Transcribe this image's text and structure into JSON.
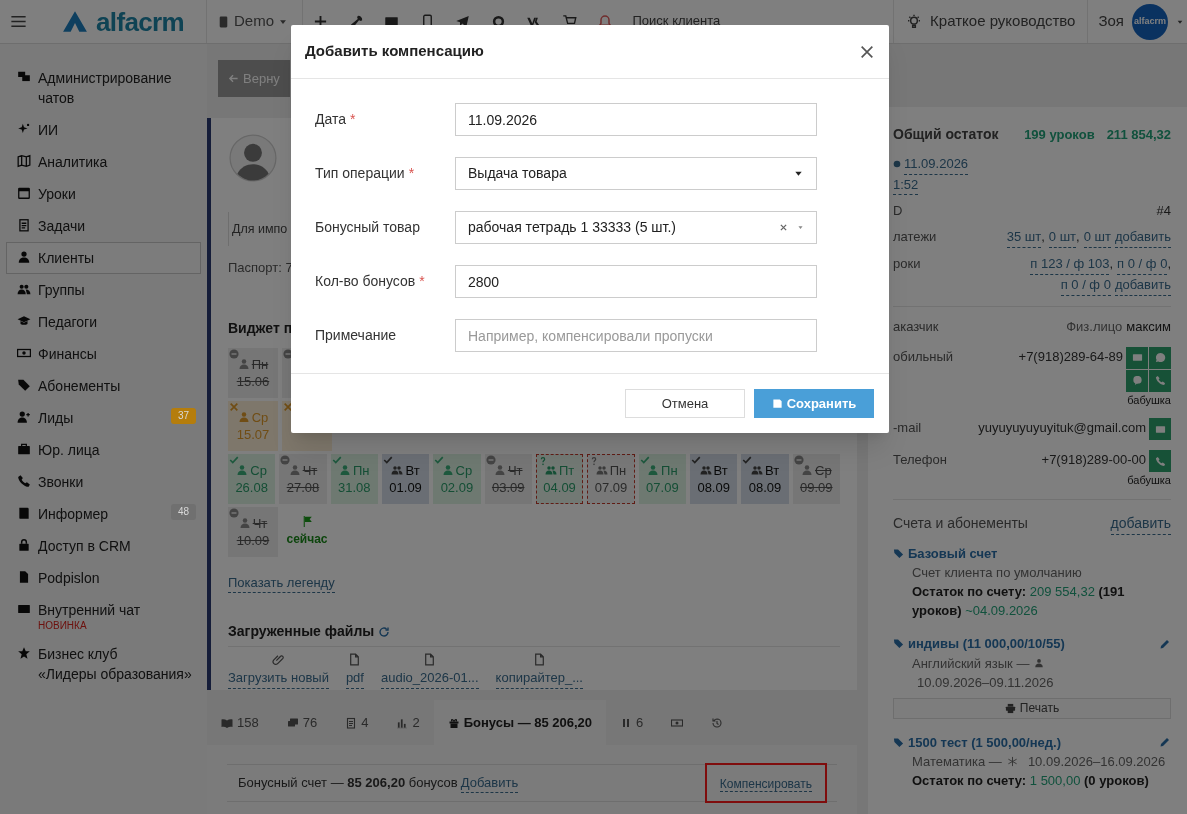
{
  "top_bar": {
    "logo": "alfacrm",
    "branch": "Demo",
    "search_placeholder": "Поиск клиента",
    "guide": "Краткое руководство",
    "user": "Зоя",
    "avatar_text": "alfacrm"
  },
  "sidebar": {
    "items": [
      {
        "label": "Администрирование чатов",
        "selected": false
      },
      {
        "label": "ИИ",
        "selected": false
      },
      {
        "label": "Аналитика",
        "selected": false
      },
      {
        "label": "Уроки",
        "selected": false
      },
      {
        "label": "Задачи",
        "selected": false
      },
      {
        "label": "Клиенты",
        "selected": true
      },
      {
        "label": "Группы",
        "selected": false
      },
      {
        "label": "Педагоги",
        "selected": false
      },
      {
        "label": "Финансы",
        "selected": false
      },
      {
        "label": "Абонементы",
        "selected": false
      },
      {
        "label": "Лиды",
        "selected": false,
        "badge": "37",
        "color": "#b57d0c"
      },
      {
        "label": "Юр. лица",
        "selected": false
      },
      {
        "label": "Звонки",
        "selected": false
      },
      {
        "label": "Информер",
        "selected": false,
        "badge": "48",
        "color": "#707070"
      },
      {
        "label": "Доступ в CRM",
        "selected": false
      },
      {
        "label": "Podpislon",
        "selected": false
      },
      {
        "label": "Внутренний чат",
        "selected": false,
        "note": "НОВИНКА"
      },
      {
        "label": "Бизнес клуб\n«Лидеры образования»",
        "selected": false
      }
    ]
  },
  "main": {
    "back_button": "Верну",
    "import_note": "Для импо",
    "passport": "Паспорт: 7",
    "widget_title": "Виджет п",
    "lesson_rows": [
      [
        {
          "kind": "cancelled",
          "weekday": "Пн",
          "date": "15.06",
          "group": false
        },
        {
          "kind": "cancelled"
        }
      ],
      [
        {
          "kind": "missed",
          "weekday": "Ср",
          "date": "15.07",
          "group": false
        },
        {
          "kind": "missed"
        }
      ],
      [
        {
          "kind": "attended",
          "weekday": "Ср",
          "date": "26.08",
          "group": false
        },
        {
          "kind": "cancelled",
          "weekday": "Чт",
          "date": "27.08",
          "group": false
        },
        {
          "kind": "attended",
          "weekday": "Пн",
          "date": "31.08",
          "group": false
        },
        {
          "kind": "visited",
          "weekday": "Вт",
          "date": "01.09",
          "group": true
        },
        {
          "kind": "attended",
          "weekday": "Ср",
          "date": "02.09",
          "group": false
        },
        {
          "kind": "cancelled",
          "weekday": "Чт",
          "date": "03.09",
          "group": false
        },
        {
          "kind": "pending_attended",
          "weekday": "Пт",
          "date": "04.09",
          "group": true
        },
        {
          "kind": "pending",
          "weekday": "Пн",
          "date": "07.09",
          "group": true
        },
        {
          "kind": "attended",
          "weekday": "Пн",
          "date": "07.09",
          "group": false
        },
        {
          "kind": "visited",
          "weekday": "Вт",
          "date": "08.09",
          "group": true
        },
        {
          "kind": "visited",
          "weekday": "Вт",
          "date": "08.09",
          "group": true
        },
        {
          "kind": "cancelled",
          "weekday": "Ср",
          "date": "09.09",
          "group": false
        }
      ],
      [
        {
          "kind": "cancelled",
          "weekday": "Чт",
          "date": "10.09",
          "group": false
        },
        {
          "kind": "now",
          "label": "сейчас"
        }
      ]
    ],
    "legend_link": "Показать легенду",
    "files_title": "Загруженные файлы",
    "files": [
      {
        "kind": "upload",
        "label": "Загрузить новый"
      },
      {
        "kind": "file",
        "label": "pdf"
      },
      {
        "kind": "file",
        "label": "audio_2026-01..."
      },
      {
        "kind": "file",
        "label": "копирайтер_..."
      }
    ]
  },
  "tabs": [
    {
      "label": "158",
      "selected": false
    },
    {
      "label": "76",
      "selected": false
    },
    {
      "label": "4",
      "selected": false
    },
    {
      "label": "2",
      "selected": false
    },
    {
      "label": "Бонусы — 85 206,20",
      "selected": true
    },
    {
      "label": "6",
      "selected": false
    },
    {
      "selected": false
    },
    {
      "selected": false
    }
  ],
  "bonus": {
    "text": "Бонусный счет — **85 206,20** бонусов",
    "add_link": "Добавить",
    "compensate_link": "Компенсировать",
    "highlighted": true
  },
  "client_panel": {
    "summary": {
      "label": "Общий остаток",
      "lessons": "199 уроков",
      "amount": "211 854,32",
      "date": "11.09.2026",
      "time": "1:52"
    },
    "info": [
      {
        "label": "D",
        "values": [
          {
            "kind": "plain",
            "text": "#4"
          }
        ]
      },
      {
        "label": "латежи",
        "values": [
          {
            "kind": "link",
            "text": "35 шт"
          },
          {
            "kind": "plain",
            "text": ","
          },
          {
            "kind": "link",
            "text": "0 шт"
          },
          {
            "kind": "plain",
            "text": ","
          },
          {
            "kind": "link",
            "text": "0 шт"
          },
          {
            "kind": "link",
            "text": "добавить"
          }
        ]
      },
      {
        "label": "роки",
        "values": [
          {
            "kind": "link",
            "text": "п 123 / ф 103"
          },
          {
            "kind": "plain",
            "text": ","
          },
          {
            "kind": "link",
            "text": "п 0 / ф 0"
          },
          {
            "kind": "plain",
            "text": ","
          },
          {
            "kind": "link",
            "text": "п 0 / ф 0"
          },
          {
            "kind": "link",
            "text": "добавить"
          }
        ]
      }
    ],
    "customer": {
      "label": "аказчик",
      "type": "Физ.лицо",
      "name": "максим"
    },
    "contacts": [
      {
        "label": "обильный",
        "value": "+7(918)289-64-89",
        "actions": [
          {
            "kind": "sms"
          },
          {
            "kind": "whatsapp"
          },
          {
            "kind": "viber"
          },
          {
            "kind": "call"
          }
        ],
        "note": "бабушка"
      },
      {
        "label": "-mail",
        "value": "yuyuyuyuyuyituk@gmail.com",
        "actions": [
          {
            "kind": "sms"
          }
        ]
      },
      {
        "label": "Телефон",
        "value": "+7(918)289-00-00",
        "actions": [
          {
            "kind": "call"
          }
        ],
        "note": "бабушка"
      }
    ],
    "accounts_title": "Счета и абонементы",
    "accounts_add": "добавить",
    "accounts": [
      {
        "title": "Базовый счет",
        "editable": false,
        "description": "Счет клиента по умолчанию",
        "balance": {
          "label": "Остаток по счету:",
          "amount": "209 554,32",
          "rest": "(191 уроков)",
          "date": "~04.09.2026"
        }
      },
      {
        "title": "индивы (11 000,00/10/55)",
        "editable": true,
        "subject": "Английский язык —",
        "kind": "single_teacher",
        "period": "10.09.2026–09.11.2026",
        "print_button": "Печать"
      },
      {
        "title": "1500 тест (1 500,00/нед.)",
        "editable": true,
        "subject": "Математика —",
        "kind": "no_teacher",
        "period": "10.09.2026–16.09.2026",
        "balance": {
          "label": "Остаток по счету:",
          "amount": "1 500,00",
          "rest": "(0 уроков)"
        }
      }
    ]
  },
  "modal": {
    "title": "Добавить компенсацию",
    "fields": [
      {
        "kind": "text",
        "label": "Дата",
        "mark": "*",
        "value": "11.09.2026"
      },
      {
        "kind": "select",
        "label": "Тип операции",
        "mark": "*",
        "value": "Выдача товара"
      },
      {
        "kind": "combo",
        "label": "Бонусный товар",
        "value": "рабочая тетрадь 1 33333 (5 шт.)"
      },
      {
        "kind": "text",
        "label": "Кол-во бонусов",
        "mark": "*",
        "value": "2800"
      },
      {
        "kind": "text",
        "label": "Примечание",
        "placeholder": "Например, компенсировали пропуски"
      }
    ],
    "cancel": "Отмена",
    "save": "Сохранить"
  }
}
